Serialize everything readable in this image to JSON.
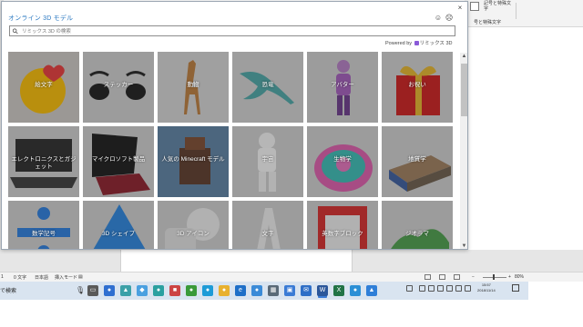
{
  "dialog": {
    "title": "オンライン 3D モデル",
    "search_placeholder": "リミックス 3D の検索",
    "powered_by_prefix": "Powered by",
    "powered_by_brand": "リミックス 3D",
    "close_glyph": "×",
    "feedback_glyph_1": "☺",
    "feedback_glyph_2": "☹"
  },
  "categories": [
    {
      "label": "絵文字"
    },
    {
      "label": "ステッカー"
    },
    {
      "label": "動物"
    },
    {
      "label": "恐竜"
    },
    {
      "label": "アバター"
    },
    {
      "label": "お祝い"
    },
    {
      "label": "エレクトロニクスとガジェット"
    },
    {
      "label": "マイクロソフト製品"
    },
    {
      "label": "人気の Minecraft モデル"
    },
    {
      "label": "宇宙"
    },
    {
      "label": "生物学"
    },
    {
      "label": "地質学"
    },
    {
      "label": "数学記号"
    },
    {
      "label": "3D シェイプ"
    },
    {
      "label": "3D アイコン"
    },
    {
      "label": "文字"
    },
    {
      "label": "英数字ブロック"
    },
    {
      "label": "ジオラマ"
    }
  ],
  "ribbon": {
    "line1": "記号と特殊文字",
    "line2": "号と特殊文字"
  },
  "statusbar": {
    "page": "1",
    "words": "0 文字",
    "language": "日本語",
    "mode": "挿入モード",
    "zoom": "80%"
  },
  "taskbar": {
    "search_label": "で検索",
    "time": "15:57",
    "date": "2018/11/14"
  },
  "colors": {
    "accent": "#2b79c2",
    "taskbar": "#d9e4f0"
  }
}
